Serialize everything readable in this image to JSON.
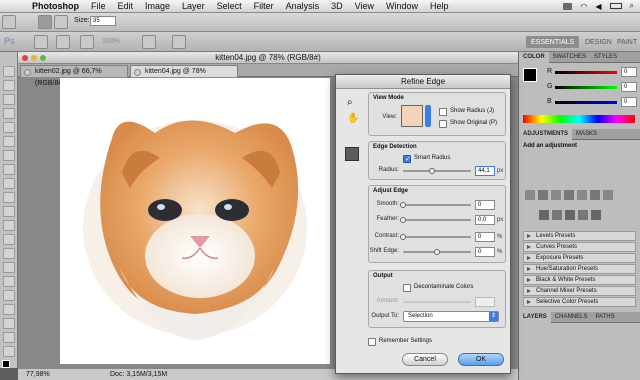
{
  "menubar": {
    "app_name": "Photoshop",
    "items": [
      "File",
      "Edit",
      "Image",
      "Layer",
      "Select",
      "Filter",
      "Analysis",
      "3D",
      "View",
      "Window",
      "Help"
    ]
  },
  "options": {
    "size_label": "Size:",
    "size_value": "35"
  },
  "options2": {
    "ps_label": "Ps",
    "zoom": "100%",
    "workspaces": {
      "essentials": "ESSENTIALS",
      "design": "DESIGN",
      "paint": "PAINT"
    }
  },
  "document": {
    "window_title": "kitten04.jpg @ 78% (RGB/8#)",
    "tabs": [
      "kitten02.jpg @ 66,7% (RGB/8#)",
      "kitten04.jpg @ 78% (RGB/8#)"
    ]
  },
  "status": {
    "zoom": "77,98%",
    "doc": "Doc: 3,15M/3,15M"
  },
  "panels": {
    "color_tabs": [
      "COLOR",
      "SWATCHES",
      "STYLES"
    ],
    "color_sliders": [
      {
        "label": "R",
        "value": "0"
      },
      {
        "label": "G",
        "value": "0"
      },
      {
        "label": "B",
        "value": "0"
      }
    ],
    "adjust_tabs": [
      "ADJUSTMENTS",
      "MASKS"
    ],
    "adjust_header": "Add an adjustment",
    "presets": [
      "Levels Presets",
      "Curves Presets",
      "Exposure Presets",
      "Hue/Saturation Presets",
      "Black & White Presets",
      "Channel Mixer Presets",
      "Selective Color Presets"
    ],
    "layer_tabs": [
      "LAYERS",
      "CHANNELS",
      "PATHS"
    ]
  },
  "dialog": {
    "title": "Refine Edge",
    "view_mode": {
      "title": "View Mode",
      "view_label": "View:",
      "show_radius": "Show Radius (J)",
      "show_original": "Show Original (P)"
    },
    "edge_detection": {
      "title": "Edge Detection",
      "smart_radius": "Smart Radius",
      "radius_label": "Radius:",
      "radius_value": "44,1",
      "radius_unit": "px",
      "radius_fraction": 0.42
    },
    "adjust_edge": {
      "title": "Adjust Edge",
      "rows": [
        {
          "label": "Smooth:",
          "value": "0",
          "unit": "",
          "level": 0
        },
        {
          "label": "Feather:",
          "value": "0,0",
          "unit": "px",
          "level": 0
        },
        {
          "label": "Contrast:",
          "value": "0",
          "unit": "%",
          "level": 0
        },
        {
          "label": "Shift Edge:",
          "value": "0",
          "unit": "%",
          "level": 0.5
        }
      ]
    },
    "output": {
      "title": "Output",
      "decontaminate": "Decontaminate Colors",
      "amount_label": "Amount:",
      "output_to_label": "Output To:",
      "output_to_value": "Selection"
    },
    "remember": "Remember Settings",
    "cancel": "Cancel",
    "ok": "OK"
  }
}
